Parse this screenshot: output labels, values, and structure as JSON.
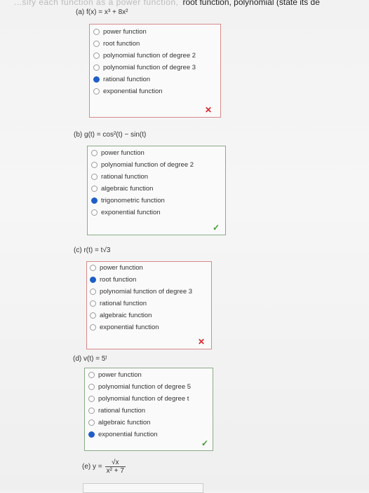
{
  "header": {
    "blurred": "...sify each function as a power function,",
    "text": "root function, polynomial (state its de"
  },
  "questions": [
    {
      "label": "(a)",
      "expr": "f(x) = x³ + 8x²",
      "options": [
        "power function",
        "root function",
        "polynomial function of degree 2",
        "polynomial function of degree 3",
        "rational function",
        "exponential function"
      ],
      "selected": 4,
      "result": "incorrect",
      "mark": "✕"
    },
    {
      "label": "(b)",
      "expr": "g(t) = cos²(t) − sin(t)",
      "options": [
        "power function",
        "polynomial function of degree 2",
        "rational function",
        "algebraic function",
        "trigonometric function",
        "exponential function"
      ],
      "selected": 4,
      "result": "correct",
      "mark": "✓"
    },
    {
      "label": "(c)",
      "expr": "r(t) = t√3",
      "options": [
        "power function",
        "root function",
        "polynomial function of degree 3",
        "rational function",
        "algebraic function",
        "exponential function"
      ],
      "selected": 1,
      "result": "incorrect",
      "mark": "✕"
    },
    {
      "label": "(d)",
      "expr": "v(t) = 5ᵗ",
      "options": [
        "power function",
        "polynomial function of degree 5",
        "polynomial function of degree t",
        "rational function",
        "algebraic function",
        "exponential function"
      ],
      "selected": 5,
      "result": "correct",
      "mark": "✓"
    },
    {
      "label": "(e)",
      "expr_prefix": "y =",
      "numerator": "√x",
      "denominator": "x² + 7"
    }
  ]
}
